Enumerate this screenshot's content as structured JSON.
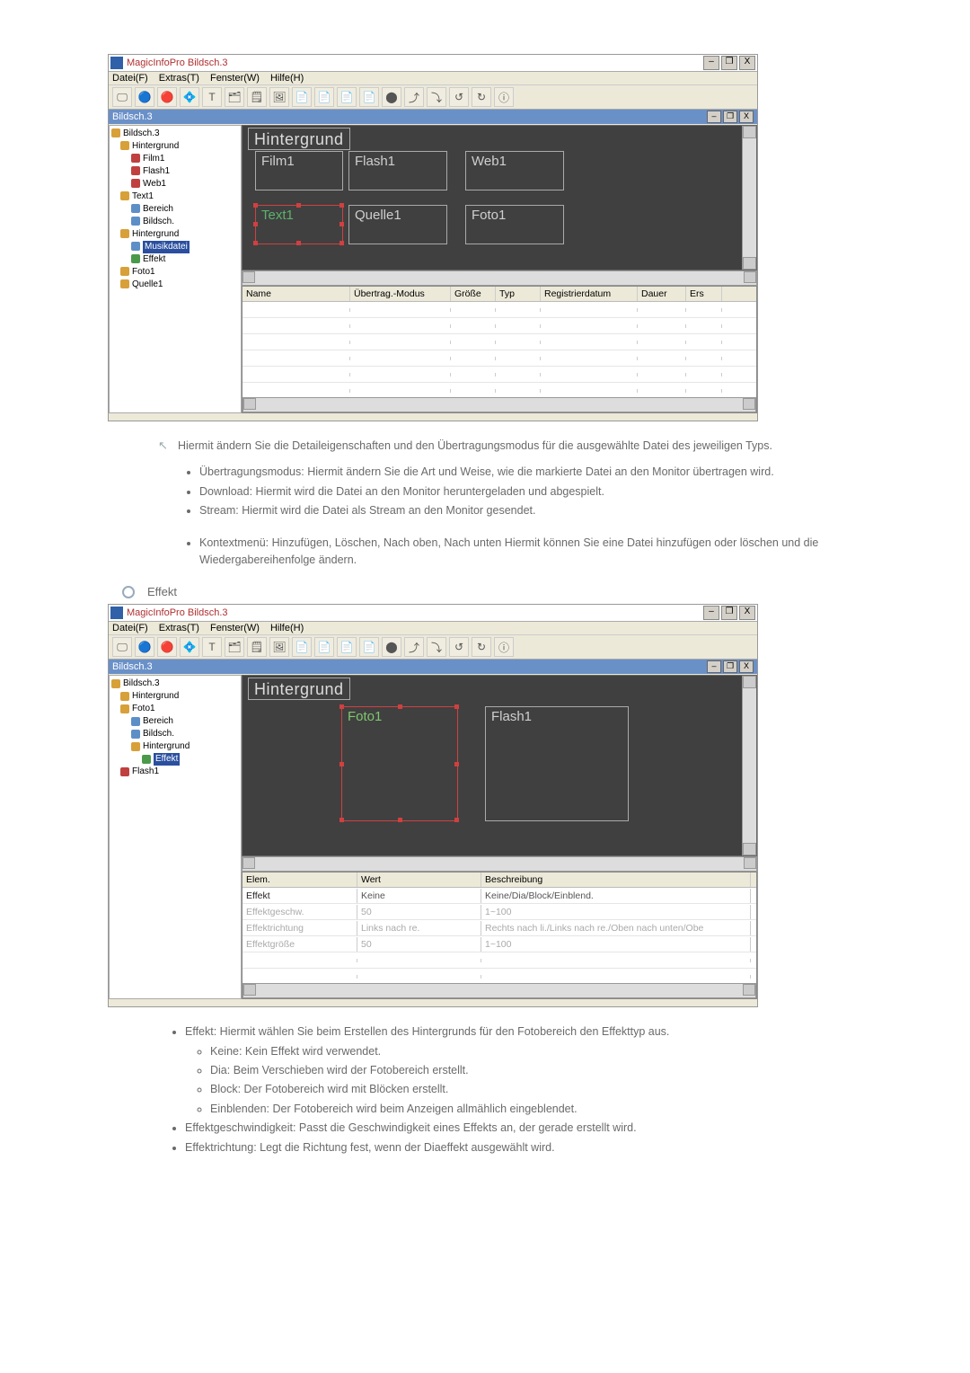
{
  "app": {
    "title": "MagicInfoPro Bildsch.3",
    "menus": [
      "Datei(F)",
      "Extras(T)",
      "Fenster(W)",
      "Hilfe(H)"
    ],
    "win_controls": {
      "min": "–",
      "restore": "❐",
      "close": "X"
    },
    "doc_name": "Bildsch.3"
  },
  "toolbar_icons": [
    "🖵",
    "🔵",
    "🔴",
    "💠",
    "T",
    "🗂",
    "🗒",
    "🖼",
    "📄",
    "📄",
    "📄",
    "📄",
    "⬤",
    "⤴",
    "⤵",
    "↺",
    "↻",
    "ⓘ"
  ],
  "screenshot1": {
    "tree": [
      {
        "t": "Bildsch.3",
        "lvl": 0,
        "ic": "fld"
      },
      {
        "t": "Hintergrund",
        "lvl": 1,
        "ic": "fld"
      },
      {
        "t": "Film1",
        "lvl": 2,
        "ic": "red"
      },
      {
        "t": "Flash1",
        "lvl": 2,
        "ic": "red"
      },
      {
        "t": "Web1",
        "lvl": 2,
        "ic": "red"
      },
      {
        "t": "Text1",
        "lvl": 1,
        "ic": "fld"
      },
      {
        "t": "Bereich",
        "lvl": 2,
        "ic": ""
      },
      {
        "t": "Bildsch.",
        "lvl": 2,
        "ic": ""
      },
      {
        "t": "Hintergrund",
        "lvl": 1,
        "ic": "fld"
      },
      {
        "t": "Musikdatei",
        "lvl": 2,
        "ic": "",
        "sel": true
      },
      {
        "t": "Effekt",
        "lvl": 2,
        "ic": "grn"
      },
      {
        "t": "Foto1",
        "lvl": 1,
        "ic": "fld"
      },
      {
        "t": "Quelle1",
        "lvl": 1,
        "ic": "fld"
      }
    ],
    "regions": {
      "bg": "Hintergrund",
      "film": "Film1",
      "flash": "Flash1",
      "web": "Web1",
      "text": "Text1",
      "quelle": "Quelle1",
      "foto": "Foto1"
    },
    "grid_headers": [
      "Name",
      "Übertrag.-Modus",
      "Größe",
      "Typ",
      "Registrierdatum",
      "Dauer",
      "Ers"
    ]
  },
  "desc1": {
    "lead": "Hiermit ändern Sie die Detaileigenschaften und den Übertragungsmodus für die ausgewählte Datei des jeweiligen Typs.",
    "bullets": [
      "Übertragungsmodus: Hiermit ändern Sie die Art und Weise, wie die markierte Datei an den Monitor übertragen wird.",
      "Download: Hiermit wird die Datei an den Monitor heruntergeladen und abgespielt.",
      "Stream: Hiermit wird die Datei als Stream an den Monitor gesendet."
    ],
    "bullets2": [
      "Kontextmenü: Hinzufügen, Löschen, Nach oben, Nach unten Hiermit können Sie eine Datei hinzufügen oder löschen und die Wiedergabereihenfolge ändern."
    ]
  },
  "section2_title": "Effekt",
  "screenshot2": {
    "tree": [
      {
        "t": "Bildsch.3",
        "lvl": 0,
        "ic": "fld"
      },
      {
        "t": "Hintergrund",
        "lvl": 1,
        "ic": "fld"
      },
      {
        "t": "Foto1",
        "lvl": 1,
        "ic": "fld"
      },
      {
        "t": "Bereich",
        "lvl": 2,
        "ic": ""
      },
      {
        "t": "Bildsch.",
        "lvl": 2,
        "ic": ""
      },
      {
        "t": "Hintergrund",
        "lvl": 2,
        "ic": "fld"
      },
      {
        "t": "Effekt",
        "lvl": 3,
        "ic": "grn",
        "sel": true
      },
      {
        "t": "Flash1",
        "lvl": 1,
        "ic": "red"
      }
    ],
    "regions": {
      "bg": "Hintergrund",
      "foto": "Foto1",
      "flash": "Flash1"
    },
    "grid_headers": [
      "Elem.",
      "Wert",
      "Beschreibung"
    ],
    "grid_rows": [
      {
        "c0": "Effekt",
        "c1": "Keine",
        "c2": "Keine/Dia/Block/Einblend."
      },
      {
        "c0": "Effektgeschw.",
        "c1": "50",
        "c2": "1~100"
      },
      {
        "c0": "Effektrichtung",
        "c1": "Links nach re.",
        "c2": "Rechts nach li./Links nach re./Oben nach unten/Obe"
      },
      {
        "c0": "Effektgröße",
        "c1": "50",
        "c2": "1~100"
      }
    ]
  },
  "desc2": {
    "bullets": [
      "Effekt: Hiermit wählen Sie beim Erstellen des Hintergrunds für den Fotobereich den Effekttyp aus."
    ],
    "sub": [
      "Keine: Kein Effekt wird verwendet.",
      "Dia: Beim Verschieben wird der Fotobereich erstellt.",
      "Block: Der Fotobereich wird mit Blöcken erstellt.",
      "Einblenden: Der Fotobereich wird beim Anzeigen allmählich eingeblendet."
    ],
    "bullets_after": [
      "Effektgeschwindigkeit: Passt die Geschwindigkeit eines Effekts an, der gerade erstellt wird.",
      "Effektrichtung: Legt die Richtung fest, wenn der Diaeffekt ausgewählt wird."
    ]
  }
}
